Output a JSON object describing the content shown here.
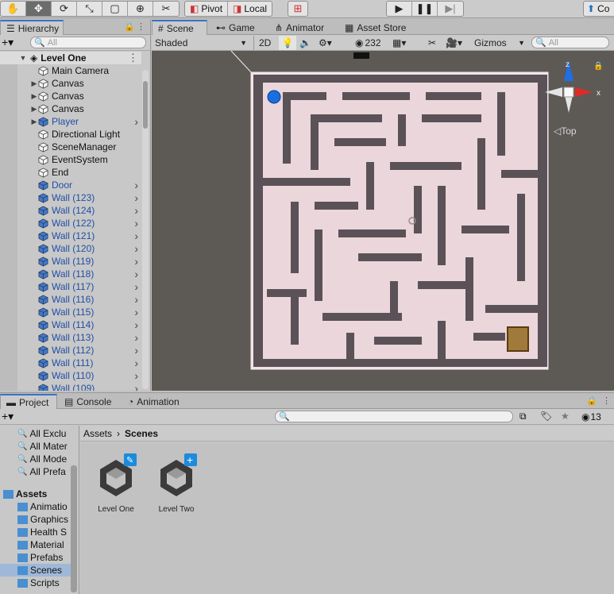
{
  "toolbar": {
    "pivot": "Pivot",
    "local": "Local",
    "collab_label": "Co"
  },
  "hierarchy": {
    "tab": "Hierarchy",
    "search_placeholder": "All",
    "scene_name": "Level One",
    "items": [
      {
        "label": "Main Camera",
        "prefab": false,
        "foldable": false
      },
      {
        "label": "Canvas",
        "prefab": false,
        "foldable": true
      },
      {
        "label": "Canvas",
        "prefab": false,
        "foldable": true
      },
      {
        "label": "Canvas",
        "prefab": false,
        "foldable": true
      },
      {
        "label": "Player",
        "prefab": true,
        "foldable": true
      },
      {
        "label": "Directional Light",
        "prefab": false,
        "foldable": false
      },
      {
        "label": "SceneManager",
        "prefab": false,
        "foldable": false
      },
      {
        "label": "EventSystem",
        "prefab": false,
        "foldable": false
      },
      {
        "label": "End",
        "prefab": false,
        "foldable": false
      },
      {
        "label": "Door",
        "prefab": true,
        "foldable": false
      },
      {
        "label": "Wall (123)",
        "prefab": true,
        "foldable": false
      },
      {
        "label": "Wall (124)",
        "prefab": true,
        "foldable": false
      },
      {
        "label": "Wall (122)",
        "prefab": true,
        "foldable": false
      },
      {
        "label": "Wall (121)",
        "prefab": true,
        "foldable": false
      },
      {
        "label": "Wall (120)",
        "prefab": true,
        "foldable": false
      },
      {
        "label": "Wall (119)",
        "prefab": true,
        "foldable": false
      },
      {
        "label": "Wall (118)",
        "prefab": true,
        "foldable": false
      },
      {
        "label": "Wall (117)",
        "prefab": true,
        "foldable": false
      },
      {
        "label": "Wall (116)",
        "prefab": true,
        "foldable": false
      },
      {
        "label": "Wall (115)",
        "prefab": true,
        "foldable": false
      },
      {
        "label": "Wall (114)",
        "prefab": true,
        "foldable": false
      },
      {
        "label": "Wall (113)",
        "prefab": true,
        "foldable": false
      },
      {
        "label": "Wall (112)",
        "prefab": true,
        "foldable": false
      },
      {
        "label": "Wall (111)",
        "prefab": true,
        "foldable": false
      },
      {
        "label": "Wall (110)",
        "prefab": true,
        "foldable": false
      },
      {
        "label": "Wall (109)",
        "prefab": true,
        "foldable": false
      }
    ]
  },
  "scene_tabs": {
    "scene": "Scene",
    "game": "Game",
    "animator": "Animator",
    "asset_store": "Asset Store"
  },
  "scene_toolbar": {
    "shading": "Shaded",
    "mode_2d": "2D",
    "hidden_count": "232",
    "gizmos": "Gizmos",
    "search_placeholder": "All"
  },
  "orientation": {
    "view_label": "Top",
    "axis_z": "z",
    "axis_x": "x"
  },
  "project_tabs": {
    "project": "Project",
    "console": "Console",
    "animation": "Animation"
  },
  "project": {
    "hidden_count": "13",
    "favorites": [
      "All Exclu",
      "All Mater",
      "All Mode",
      "All Prefa"
    ],
    "assets_root": "Assets",
    "folders": [
      "Animatio",
      "Graphics",
      "Health S",
      "Material",
      "Prefabs",
      "Scenes",
      "Scripts"
    ],
    "selected_folder": "Scenes",
    "breadcrumb": [
      "Assets",
      "Scenes"
    ],
    "assets": [
      {
        "label": "Level One",
        "badge": "edit"
      },
      {
        "label": "Level Two",
        "badge": "add"
      }
    ]
  },
  "colors": {
    "selection": "#3a72c4",
    "prefab_text": "#1f4fa6",
    "maze_floor": "#ead6db",
    "maze_wall": "#5b5257",
    "scene_bg": "#5d5a56",
    "player": "#1a6fe0"
  }
}
